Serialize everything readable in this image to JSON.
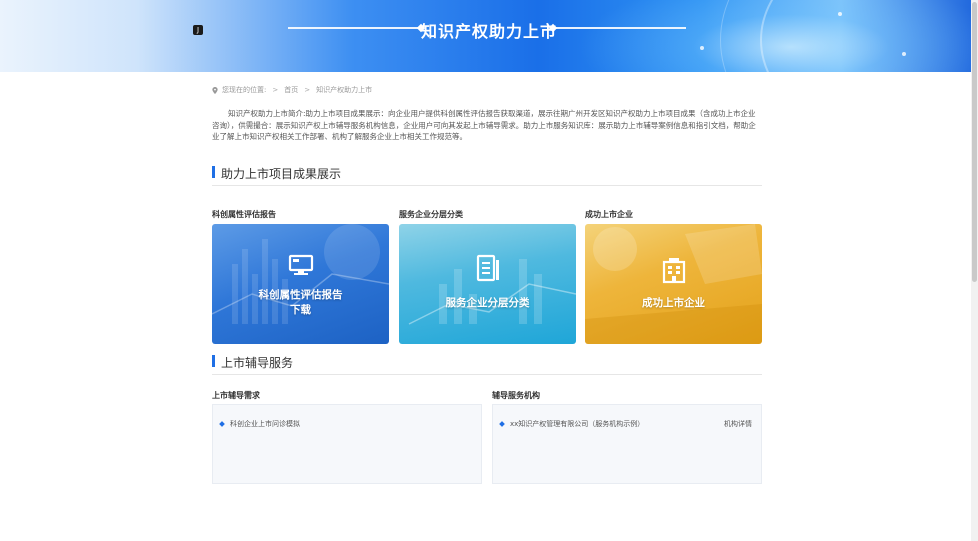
{
  "banner": {
    "title": "知识产权助力上市",
    "badge_icon": "app-badge-icon"
  },
  "breadcrumb": {
    "location_label": "您现在的位置:",
    "items": [
      "首页",
      "知识产权助力上市"
    ]
  },
  "intro": {
    "text": "知识产权助力上市简介:助力上市项目成果展示：向企业用户提供科创属性评估报告获取渠道，展示往期广州开发区知识产权助力上市项目成果（含成功上市企业咨询），供需撮合：展示知识产权上市辅导服务机构信息，企业用户可向其发起上市辅导需求。助力上市服务知识库：展示助力上市辅导案例信息和指引文档，帮助企业了解上市知识产权相关工作部署、机构了解服务企业上市相关工作规范等。"
  },
  "section1": {
    "title": "助力上市项目成果展示",
    "cards": [
      {
        "label": "科创属性评估报告",
        "overlay_line1": "科创属性评估报告",
        "overlay_line2": "下载",
        "icon": "computer-monitor-icon"
      },
      {
        "label": "服务企业分层分类",
        "overlay_line1": "服务企业分层分类",
        "icon": "document-list-icon"
      },
      {
        "label": "成功上市企业",
        "overlay_line1": "成功上市企业",
        "icon": "building-icon"
      }
    ]
  },
  "section2": {
    "title": "上市辅导服务",
    "left": {
      "label": "上市辅导需求",
      "items": [
        {
          "text": "科创企业上市问诊模拟"
        }
      ]
    },
    "right": {
      "label": "辅导服务机构",
      "items": [
        {
          "text": "xx知识产权管理有限公司（服务机构示例）",
          "link": "机构详情"
        }
      ]
    }
  },
  "colors": {
    "accent": "#1f6fe5",
    "card_blue": "#2f77d8",
    "card_cyan": "#4fb9df",
    "card_gold": "#eeb53b"
  }
}
